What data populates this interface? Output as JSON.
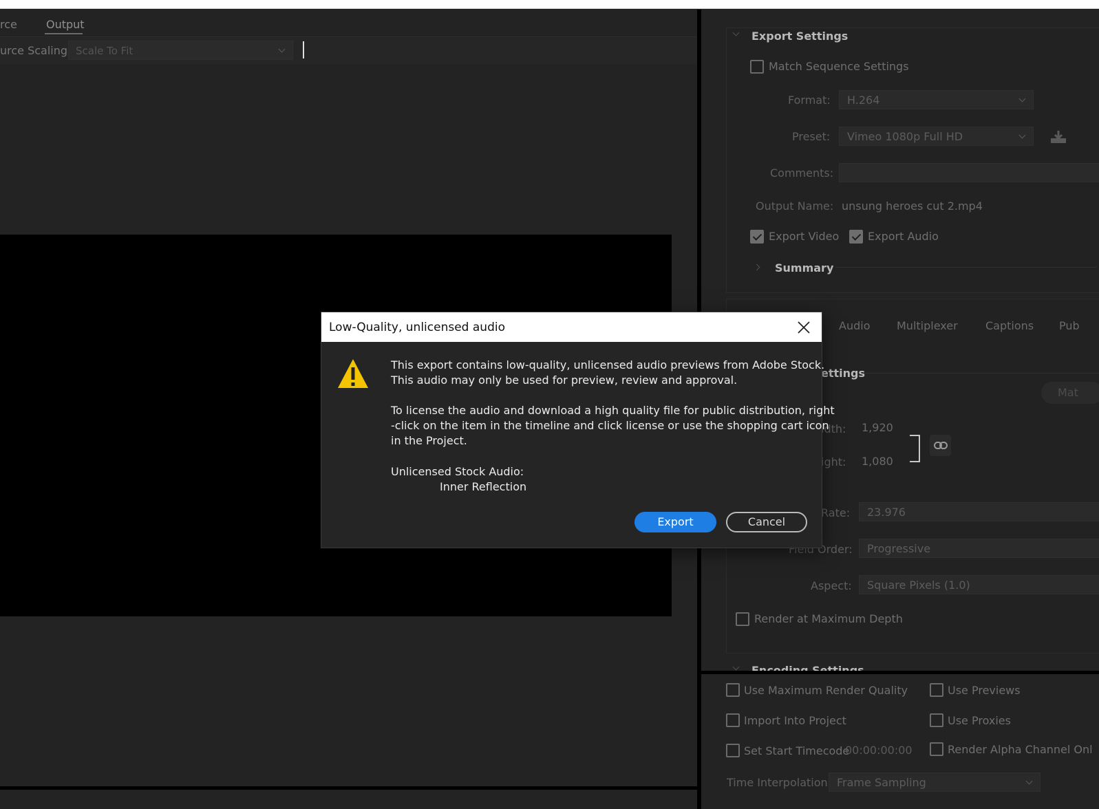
{
  "left_pane": {
    "tabs": [
      {
        "label": "rce"
      },
      {
        "label": "Output"
      }
    ],
    "source_scaling_label": "urce Scaling:",
    "source_scaling_value": "Scale To Fit"
  },
  "export_settings": {
    "title": "Export Settings",
    "match_sequence_label": "Match Sequence Settings",
    "format_label": "Format:",
    "format_value": "H.264",
    "preset_label": "Preset:",
    "preset_value": "Vimeo 1080p Full HD",
    "comments_label": "Comments:",
    "comments_value": "",
    "output_name_label": "Output Name:",
    "output_name_value": "unsung heroes cut 2.mp4",
    "export_video_label": "Export Video",
    "export_video_checked": true,
    "export_audio_label": "Export Audio",
    "export_audio_checked": true,
    "summary_label": "Summary"
  },
  "sub_tabs": [
    {
      "label": "Audio"
    },
    {
      "label": "Multiplexer"
    },
    {
      "label": "Captions"
    },
    {
      "label": "Pub"
    }
  ],
  "video_settings": {
    "section_title_partial": "ettings",
    "match_button_partial": "Mat",
    "width_label": "idth:",
    "width_value": "1,920",
    "height_label": "ight:",
    "height_value": "1,080",
    "frame_rate_label": "Rate:",
    "frame_rate_value": "23.976",
    "field_order_label": "Field Order:",
    "field_order_value": "Progressive",
    "aspect_label": "Aspect:",
    "aspect_value": "Square Pixels (1.0)",
    "render_max_depth_label": "Render at Maximum Depth",
    "encoding_settings_title": "Encoding Settings"
  },
  "bottom_options": {
    "use_max_render_quality": "Use Maximum Render Quality",
    "use_previews": "Use Previews",
    "import_into_project": "Import Into Project",
    "use_proxies": "Use Proxies",
    "set_start_timecode": "Set Start Timecode",
    "start_timecode_value": "00:00:00:00",
    "render_alpha": "Render Alpha Channel Onl",
    "time_interpolation_label": "Time Interpolation:",
    "time_interpolation_value": "Frame Sampling"
  },
  "dialog": {
    "title": "Low-Quality, unlicensed audio",
    "line1": "This export contains low-quality, unlicensed audio previews from Adobe Stock.",
    "line2": "This audio may only be used for preview, review and approval.",
    "line3": "To license the audio and download a high quality file for public distribution, right",
    "line4": "-click on the item in the timeline and click license or use the shopping cart icon",
    "line5": "in the Project.",
    "unlicensed_label": "Unlicensed Stock Audio:",
    "track_name": "Inner Reflection",
    "export_button": "Export",
    "cancel_button": "Cancel",
    "icons": {
      "warning": "warning-triangle-icon",
      "close": "close-icon"
    },
    "colors": {
      "primary": "#1e7ee4",
      "warning": "#f5c400"
    }
  }
}
